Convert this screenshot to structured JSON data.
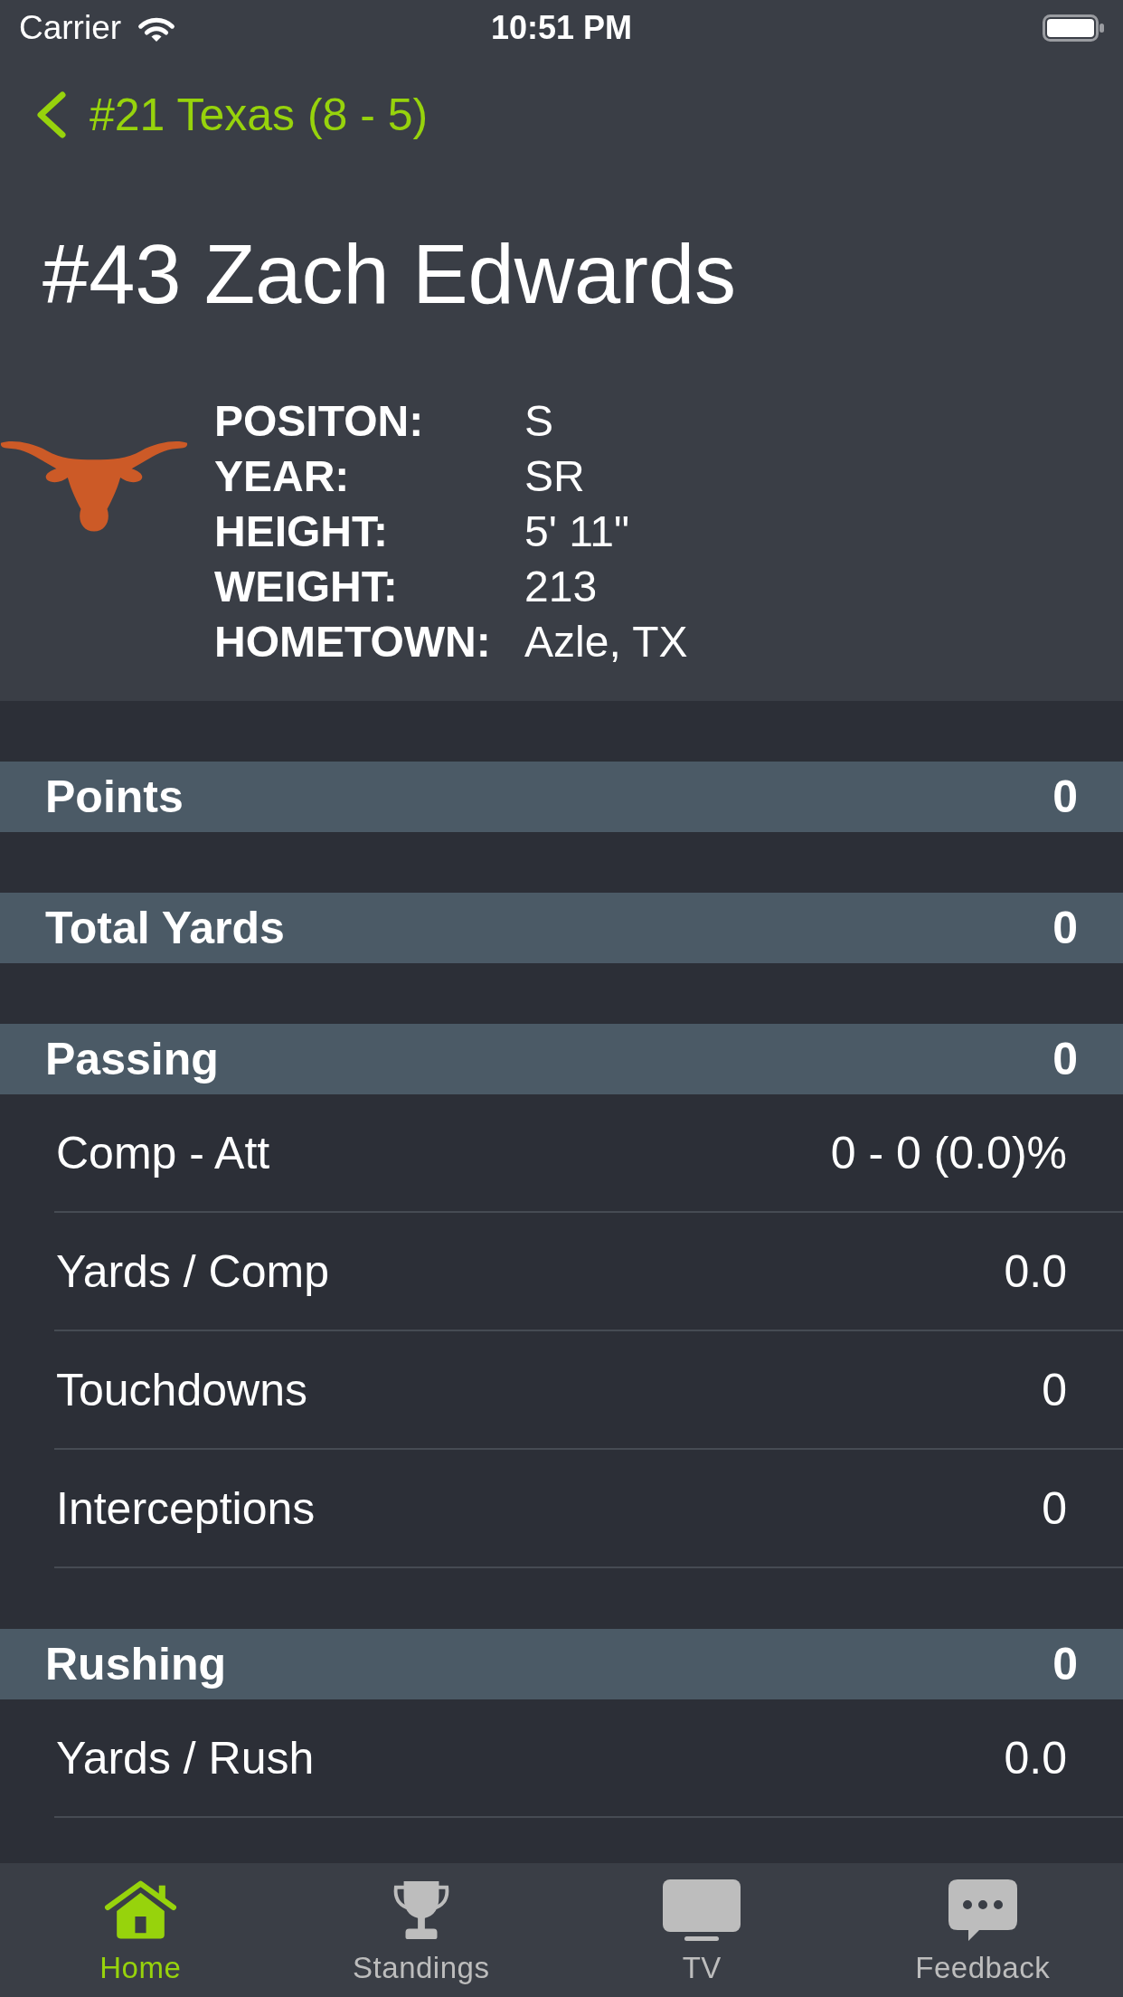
{
  "status_bar": {
    "carrier": "Carrier",
    "time": "10:51 PM"
  },
  "nav": {
    "back": "#21 Texas (8 - 5)"
  },
  "player": {
    "name": "#43 Zach Edwards",
    "details": [
      {
        "label": "POSITON:",
        "value": "S"
      },
      {
        "label": "YEAR:",
        "value": "SR"
      },
      {
        "label": "HEIGHT:",
        "value": "5' 11\""
      },
      {
        "label": "WEIGHT:",
        "value": "213"
      },
      {
        "label": "HOMETOWN:",
        "value": "Azle, TX"
      }
    ]
  },
  "sections": [
    {
      "title": "Points",
      "value": "0"
    },
    {
      "title": "Total Yards",
      "value": "0"
    },
    {
      "title": "Passing",
      "value": "0",
      "rows": [
        {
          "label": "Comp - Att",
          "value": "0 - 0 (0.0)%"
        },
        {
          "label": "Yards / Comp",
          "value": "0.0"
        },
        {
          "label": "Touchdowns",
          "value": "0"
        },
        {
          "label": "Interceptions",
          "value": "0"
        }
      ]
    },
    {
      "title": "Rushing",
      "value": "0",
      "rows": [
        {
          "label": "Yards / Rush",
          "value": "0.0"
        }
      ]
    }
  ],
  "tab_bar": {
    "tabs": [
      {
        "label": "Home",
        "selected": true
      },
      {
        "label": "Standings",
        "selected": false
      },
      {
        "label": "TV",
        "selected": false
      },
      {
        "label": "Feedback",
        "selected": false
      }
    ]
  }
}
